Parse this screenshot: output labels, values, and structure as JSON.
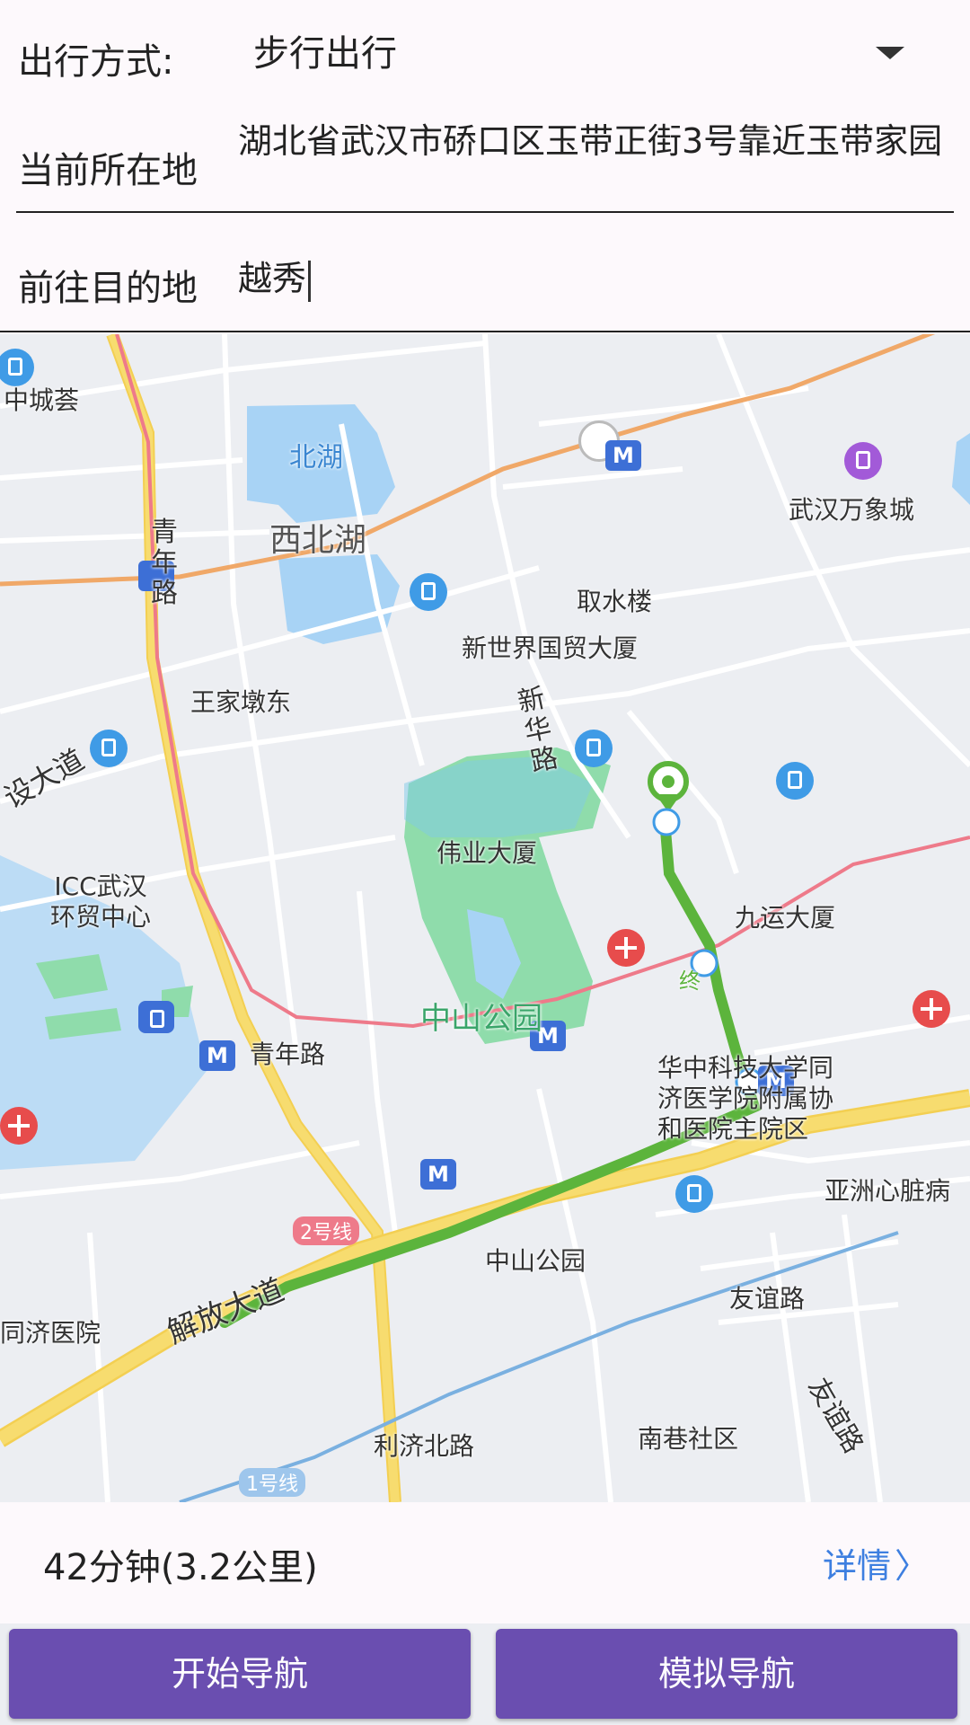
{
  "form": {
    "travel_mode_label": "出行方式:",
    "travel_mode_value": "步行出行",
    "current_location_label": "当前所在地",
    "current_location_value": "湖北省武汉市硚口区玉带正街3号靠近玉带家园",
    "destination_label": "前往目的地",
    "destination_value": "越秀"
  },
  "map": {
    "labels": {
      "zhongchenghui": "中城荟",
      "beihu": "北湖",
      "xibeihu": "西北湖",
      "wanxiangcheng": "武汉万象城",
      "qushuilou": "取水楼",
      "xinshijie": "新世界国贸大厦",
      "wangjiadundong": "王家墩东",
      "qingnianlu_vertical": "青年路",
      "xinhualu": "新华路",
      "dadao_left": "设大道",
      "weiye": "伟业大厦",
      "icc": "ICC武汉\n环贸中心",
      "jiuyun": "九运大厦",
      "zhong_mark": "终",
      "zhongshan_park": "中山公园",
      "qingnianlu_metro": "青年路",
      "tongji_xiehe": "华中科技大学同\n济医学院附属协\n和医院主院区",
      "yazhou": "亚洲心脏病",
      "line2": "2号线",
      "zhongshan_metro": "中山公园",
      "tongji": "同济医院",
      "jiefang": "解放大道",
      "youyi_metro": "友谊路",
      "lijibeilu": "利济北路",
      "nanxiang": "南巷社区",
      "youyi_road": "友谊路",
      "line1": "1号线",
      "metro_icon": "M"
    },
    "colors": {
      "route": "#5cb43c",
      "road_main": "#f7dc6f",
      "water": "#a8d3f5",
      "park": "#8fdcab"
    }
  },
  "summary": {
    "route_info": "42分钟(3.2公里)",
    "details_label": "详情",
    "details_chevron": "〉"
  },
  "buttons": {
    "start_navigation": "开始导航",
    "simulate_navigation": "模拟导航"
  }
}
